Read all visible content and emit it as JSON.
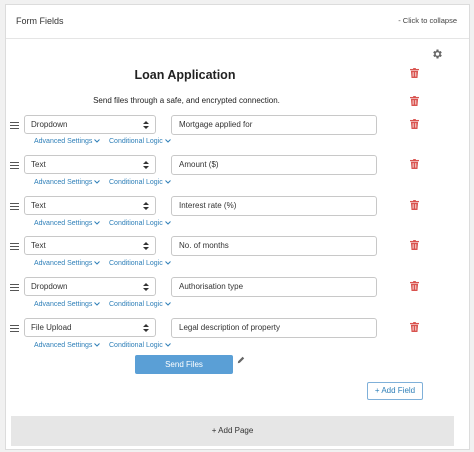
{
  "panel": {
    "title": "Form Fields",
    "collapse_hint": "- Click to collapse"
  },
  "form": {
    "title": "Loan Application",
    "subtitle": "Send files through a safe, and encrypted connection."
  },
  "fields": [
    {
      "type": "Dropdown",
      "label": "Mortgage applied for",
      "advanced": "Advanced Settings",
      "conditional": "Conditional Logic"
    },
    {
      "type": "Text",
      "label": "Amount ($)",
      "advanced": "Advanced Settings",
      "conditional": "Conditional Logic"
    },
    {
      "type": "Text",
      "label": "Interest rate (%)",
      "advanced": "Advanced Settings",
      "conditional": "Conditional Logic"
    },
    {
      "type": "Text",
      "label": "No. of months",
      "advanced": "Advanced Settings",
      "conditional": "Conditional Logic"
    },
    {
      "type": "Dropdown",
      "label": "Authorisation type",
      "advanced": "Advanced Settings",
      "conditional": "Conditional Logic"
    },
    {
      "type": "File Upload",
      "label": "Legal description of property",
      "advanced": "Advanced Settings",
      "conditional": "Conditional Logic"
    }
  ],
  "buttons": {
    "send": "Send Files",
    "add_field": "+ Add Field",
    "add_page": "+ Add Page"
  },
  "icons": {
    "settings": "gear-icon",
    "delete": "trash-icon",
    "drag": "drag-handle-icon",
    "edit": "pencil-icon"
  },
  "colors": {
    "accent": "#2e7fb8",
    "button_fill": "#5a9fd6",
    "delete": "#d9534f"
  }
}
